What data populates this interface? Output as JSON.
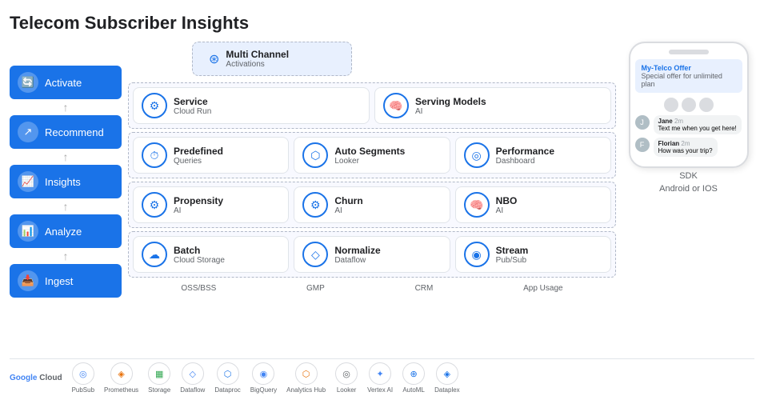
{
  "title": "Telecom Subscriber Insights",
  "sidebar": {
    "items": [
      {
        "label": "Activate",
        "icon": "🔄"
      },
      {
        "label": "Recommend",
        "icon": "↗"
      },
      {
        "label": "Insights",
        "icon": "📈"
      },
      {
        "label": "Analyze",
        "icon": "📊"
      },
      {
        "label": "Ingest",
        "icon": "📥"
      }
    ]
  },
  "diagram": {
    "multichannel": {
      "title": "Multi Channel",
      "subtitle": "Activations"
    },
    "row1": [
      {
        "title": "Service",
        "subtitle": "Cloud Run"
      },
      {
        "title": "Serving Models",
        "subtitle": "AI"
      }
    ],
    "row2": [
      {
        "title": "Predefined",
        "subtitle": "Queries"
      },
      {
        "title": "Auto Segments",
        "subtitle": "Looker"
      },
      {
        "title": "Performance",
        "subtitle": "Dashboard"
      }
    ],
    "row3": [
      {
        "title": "Propensity",
        "subtitle": "AI"
      },
      {
        "title": "Churn",
        "subtitle": "AI"
      },
      {
        "title": "NBO",
        "subtitle": "AI"
      }
    ],
    "row4": [
      {
        "title": "Batch",
        "subtitle": "Cloud Storage"
      },
      {
        "title": "Normalize",
        "subtitle": "Dataflow"
      },
      {
        "title": "Stream",
        "subtitle": "Pub/Sub"
      }
    ],
    "bottom_labels": [
      "OSS/BSS",
      "GMP",
      "CRM",
      "App Usage"
    ]
  },
  "phone": {
    "offer_title": "My-Telco Offer",
    "offer_sub": "Special offer for unlimited plan",
    "messages": [
      {
        "name": "Jane",
        "time": "2m",
        "text": "Text me when you get here!"
      },
      {
        "name": "Florian",
        "time": "2m",
        "text": "How was your trip?"
      }
    ],
    "sdk_label": "SDK",
    "os_label": "Android or IOS"
  },
  "logos": [
    {
      "label": "PubSub",
      "icon": "◎"
    },
    {
      "label": "Prometheus",
      "icon": "◈"
    },
    {
      "label": "Storage",
      "icon": "▦"
    },
    {
      "label": "Dataflow",
      "icon": "◇"
    },
    {
      "label": "Dataproc",
      "icon": "⬡"
    },
    {
      "label": "BigQuery",
      "icon": "◉"
    },
    {
      "label": "Analytics Hub",
      "icon": "⬡"
    },
    {
      "label": "Looker",
      "icon": "◎"
    },
    {
      "label": "Vertex AI",
      "icon": "✦"
    },
    {
      "label": "AutoML",
      "icon": "⊕"
    },
    {
      "label": "Dataplex",
      "icon": "◈"
    }
  ],
  "google_cloud_label": "Google Cloud"
}
